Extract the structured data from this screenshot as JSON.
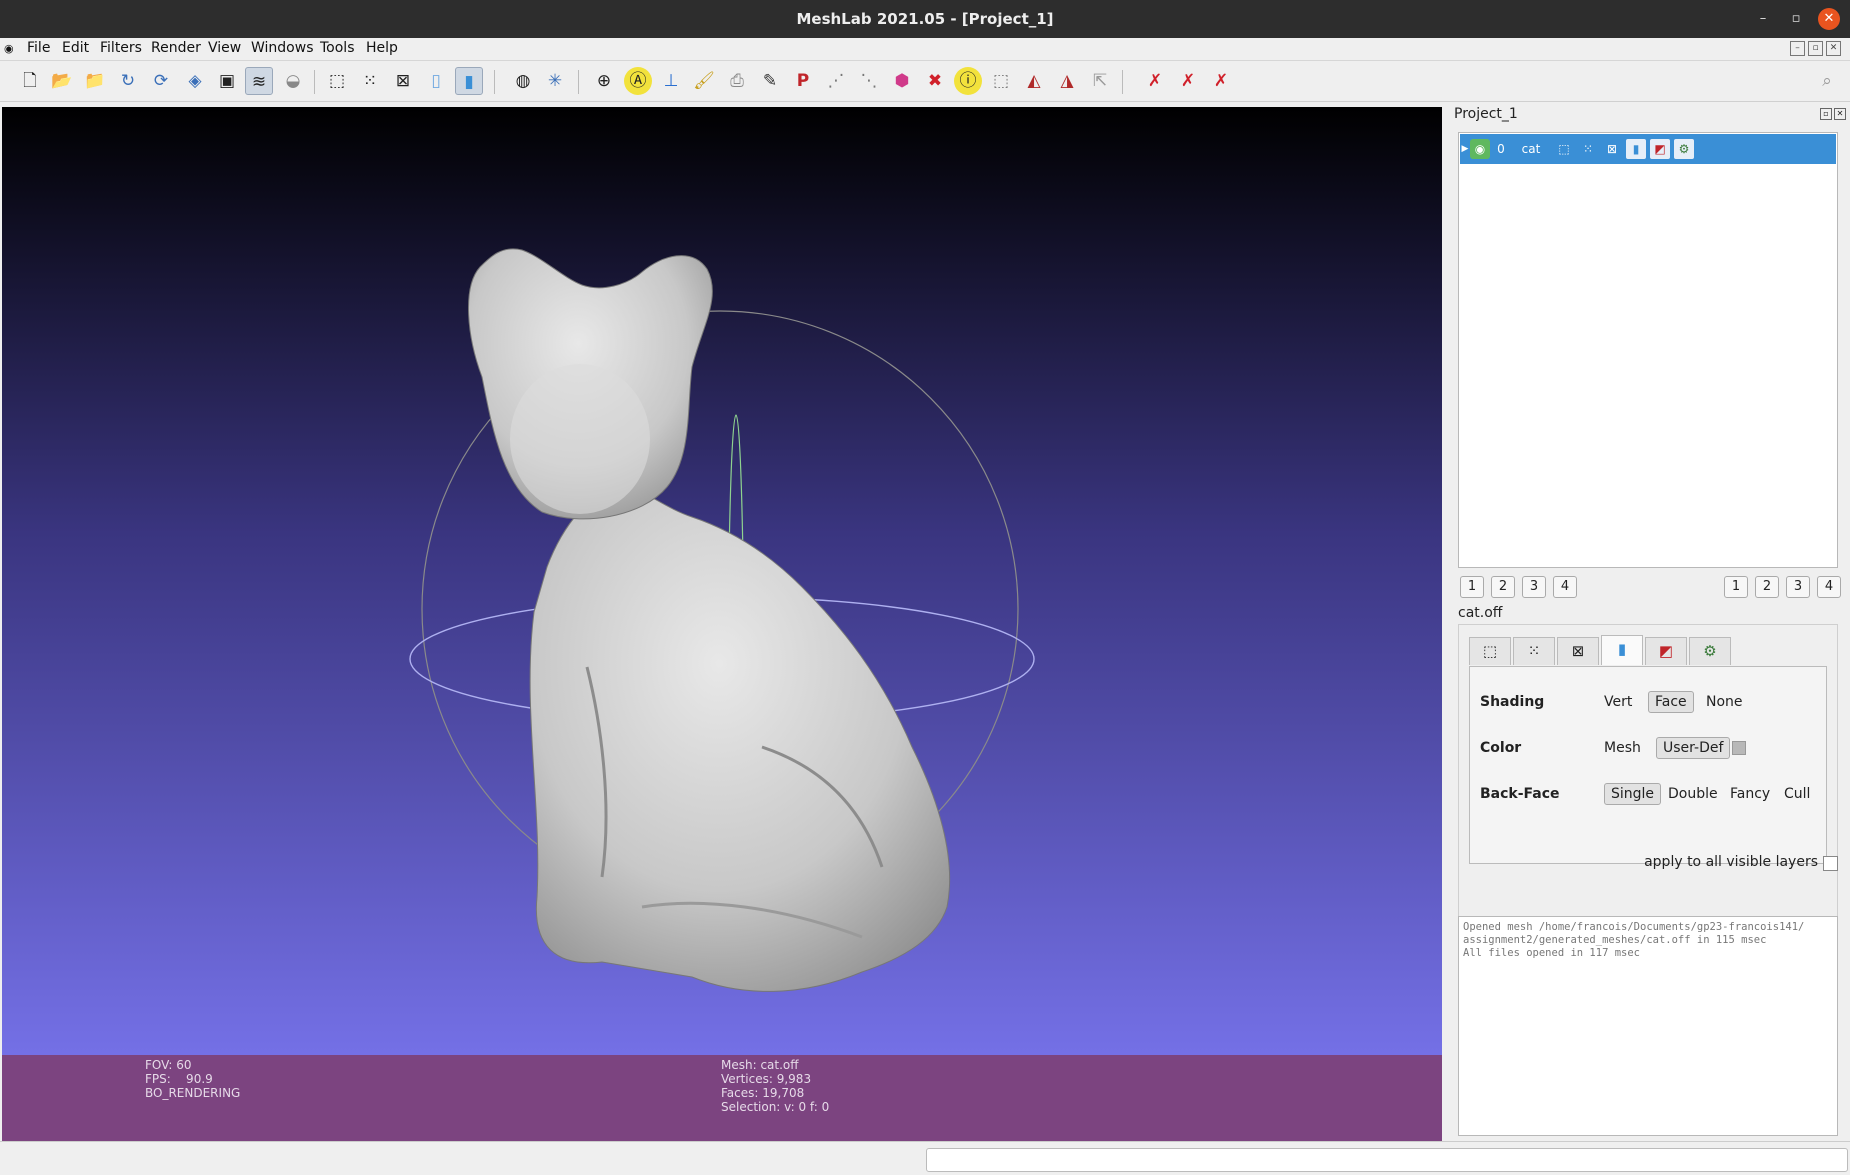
{
  "window": {
    "title": "MeshLab 2021.05 - [Project_1]"
  },
  "menu": [
    "File",
    "Edit",
    "Filters",
    "Render",
    "View",
    "Windows",
    "Tools",
    "Help"
  ],
  "viewport": {
    "info_left": "FOV: 60\nFPS:    90.9\nBO_RENDERING",
    "info_center": "Mesh: cat.off\nVertices: 9,983\nFaces: 19,708\nSelection: v: 0 f: 0"
  },
  "dock": {
    "title": "Project_1",
    "layer": {
      "index": "0",
      "name": "cat"
    },
    "page_buttons_left": [
      "1",
      "2",
      "3",
      "4"
    ],
    "page_buttons_right": [
      "1",
      "2",
      "3",
      "4"
    ],
    "mesh_name": "cat.off",
    "shading": {
      "label": "Shading",
      "options": [
        "Vert",
        "Face",
        "None"
      ],
      "selected": "Face"
    },
    "color": {
      "label": "Color",
      "options": [
        "Mesh",
        "User-Def"
      ],
      "selected": "User-Def"
    },
    "backface": {
      "label": "Back-Face",
      "options": [
        "Single",
        "Double",
        "Fancy",
        "Cull"
      ],
      "selected": "Single"
    },
    "apply_label": "apply to all visible layers",
    "log": "Opened mesh /home/francois/Documents/gp23-francois141/\nassignment2/generated_meshes/cat.off in 115 msec\nAll files opened in 117 msec"
  },
  "colors": {
    "selection": "#3a8fd6",
    "infobar": "#7c4480",
    "viewport_top": "#000000",
    "viewport_bottom": "#7470e6"
  }
}
